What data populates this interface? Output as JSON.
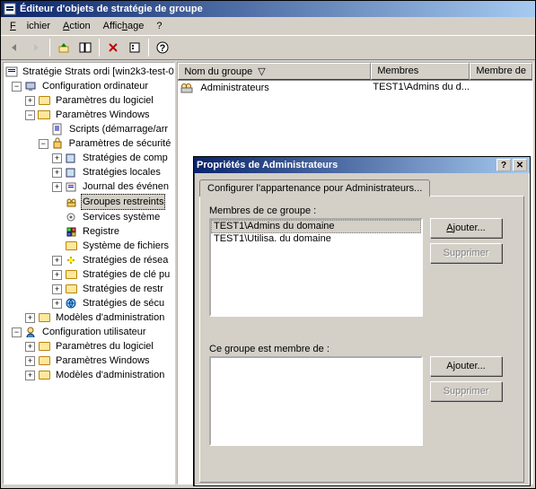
{
  "window": {
    "title": "Éditeur d'objets de stratégie de groupe"
  },
  "menu": {
    "file": "Fichier",
    "action": "Action",
    "view": "Affichage",
    "help": "?"
  },
  "tree": {
    "root": "Stratégie Strats ordi [win2k3-test-0",
    "n1": "Configuration ordinateur",
    "n1_1": "Paramètres du logiciel",
    "n1_2": "Paramètres Windows",
    "n1_2_1": "Scripts (démarrage/arr",
    "n1_2_2": "Paramètres de sécurité",
    "n1_2_2_1": "Stratégies de comp",
    "n1_2_2_2": "Stratégies locales",
    "n1_2_2_3": "Journal des événen",
    "n1_2_2_4": "Groupes restreints",
    "n1_2_2_5": "Services système",
    "n1_2_2_6": "Registre",
    "n1_2_2_7": "Système de fichiers",
    "n1_2_2_8": "Stratégies de résea",
    "n1_2_2_9": "Stratégies de clé pu",
    "n1_2_2_10": "Stratégies de restr",
    "n1_2_2_11": "Stratégies de sécu",
    "n1_3": "Modèles d'administration",
    "n2": "Configuration utilisateur",
    "n2_1": "Paramètres du logiciel",
    "n2_2": "Paramètres Windows",
    "n2_3": "Modèles d'administration"
  },
  "list": {
    "col1": "Nom du groupe",
    "col2": "Membres",
    "col3": "Membre de",
    "row1_name": "Administrateurs",
    "row1_members": "TEST1\\Admins du d..."
  },
  "dialog": {
    "title": "Propriétés de Administrateurs",
    "tab": "Configurer l'appartenance pour Administrateurs...",
    "members_label": "Membres de ce groupe :",
    "memberof_label": "Ce groupe est membre de :",
    "add": "Ajouter...",
    "remove": "Supprimer",
    "members": {
      "0": "TEST1\\Admins du domaine",
      "1": "TEST1\\Utilisa. du domaine"
    }
  }
}
